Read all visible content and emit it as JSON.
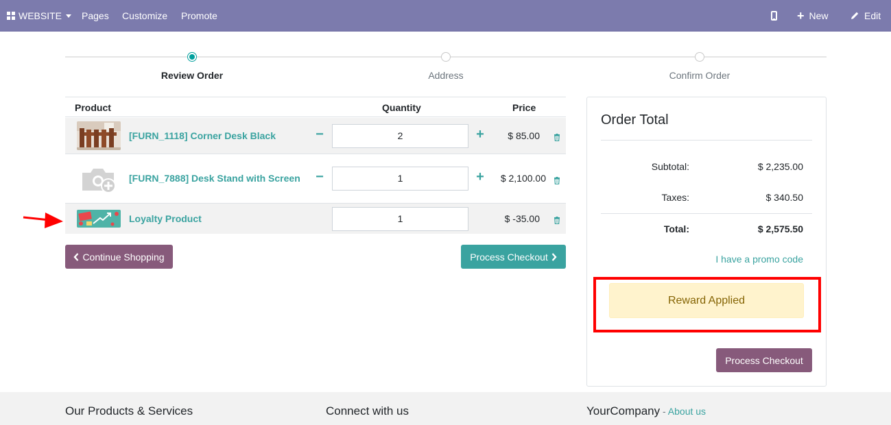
{
  "navbar": {
    "website_label": "WEBSITE",
    "menu": [
      "Pages",
      "Customize",
      "Promote"
    ],
    "new_label": "New",
    "edit_label": "Edit"
  },
  "steps": [
    {
      "label": "Review Order",
      "active": true
    },
    {
      "label": "Address",
      "active": false
    },
    {
      "label": "Confirm Order",
      "active": false
    }
  ],
  "cart": {
    "columns": {
      "product": "Product",
      "quantity": "Quantity",
      "price": "Price"
    },
    "rows": [
      {
        "name": "[FURN_1118] Corner Desk Black",
        "quantity": "2",
        "price": "$ 85.00",
        "image": "desk-photo"
      },
      {
        "name": "[FURN_7888] Desk Stand with Screen",
        "quantity": "1",
        "price": "$ 2,100.00",
        "image": "placeholder-camera-icon"
      },
      {
        "name": "Loyalty Product",
        "quantity": "1",
        "price": "$ -35.00",
        "image": "loyalty-banner"
      }
    ],
    "continue_label": "Continue Shopping",
    "checkout_label": "Process Checkout"
  },
  "order_total": {
    "title": "Order Total",
    "subtotal_label": "Subtotal:",
    "subtotal_value": "$ 2,235.00",
    "taxes_label": "Taxes:",
    "taxes_value": "$ 340.50",
    "total_label": "Total:",
    "total_value": "$ 2,575.50",
    "promo_link": "I have a promo code",
    "reward_text": "Reward Applied",
    "checkout_label": "Process Checkout"
  },
  "footer": {
    "col1": "Our Products & Services",
    "col2": "Connect with us",
    "col3": "YourCompany",
    "separator": " - ",
    "about_link": "About us"
  },
  "colors": {
    "navbar": "#7c7bad",
    "primary": "#875a7b",
    "accent": "#3aa3a0",
    "alert_bg": "#fff3cd",
    "highlight": "#ff0000"
  }
}
